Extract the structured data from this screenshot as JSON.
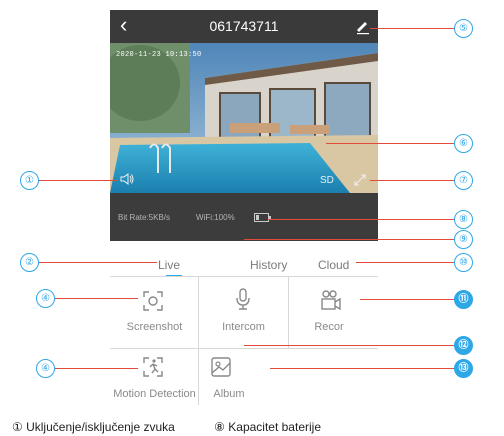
{
  "camera_screen": {
    "title": "061743711",
    "video_timestamp": "2020-11-23 10:13:50",
    "stream_quality": "SD",
    "status_bar": {
      "bit_rate": "Bit Rate:5KB/s",
      "wifi": "WiFi:100%",
      "battery_level": 0.25
    },
    "tabs": [
      {
        "label": "Live",
        "selected": true
      },
      {
        "label": "History",
        "selected": false
      },
      {
        "label": "Cloud",
        "selected": false
      }
    ],
    "grid": [
      {
        "label": "Screenshot",
        "icon": "screenshot-icon"
      },
      {
        "label": "Intercom",
        "icon": "microphone-icon"
      },
      {
        "label": "Recor",
        "icon": "video-camera-icon"
      },
      {
        "label": "Motion Detection",
        "icon": "motion-detection-icon"
      },
      {
        "label": "Album",
        "icon": "album-icon"
      }
    ]
  },
  "callouts": {
    "n1": "①",
    "n2": "②",
    "n4a": "④",
    "n4b": "④",
    "n5": "⑤",
    "n6": "⑥",
    "n7": "⑦",
    "n8": "⑧",
    "n9": "⑨",
    "n10": "⑩",
    "n11": "⑪",
    "n12": "⑫",
    "n13": "⑬"
  },
  "legend": {
    "item1": "① Uključenje/isključenje zvuka",
    "item8": "⑧ Kapacitet baterije"
  },
  "colors": {
    "accent": "#2ea7e6",
    "leader_line": "#e24a3b",
    "header_bg": "#3a3a3a"
  }
}
